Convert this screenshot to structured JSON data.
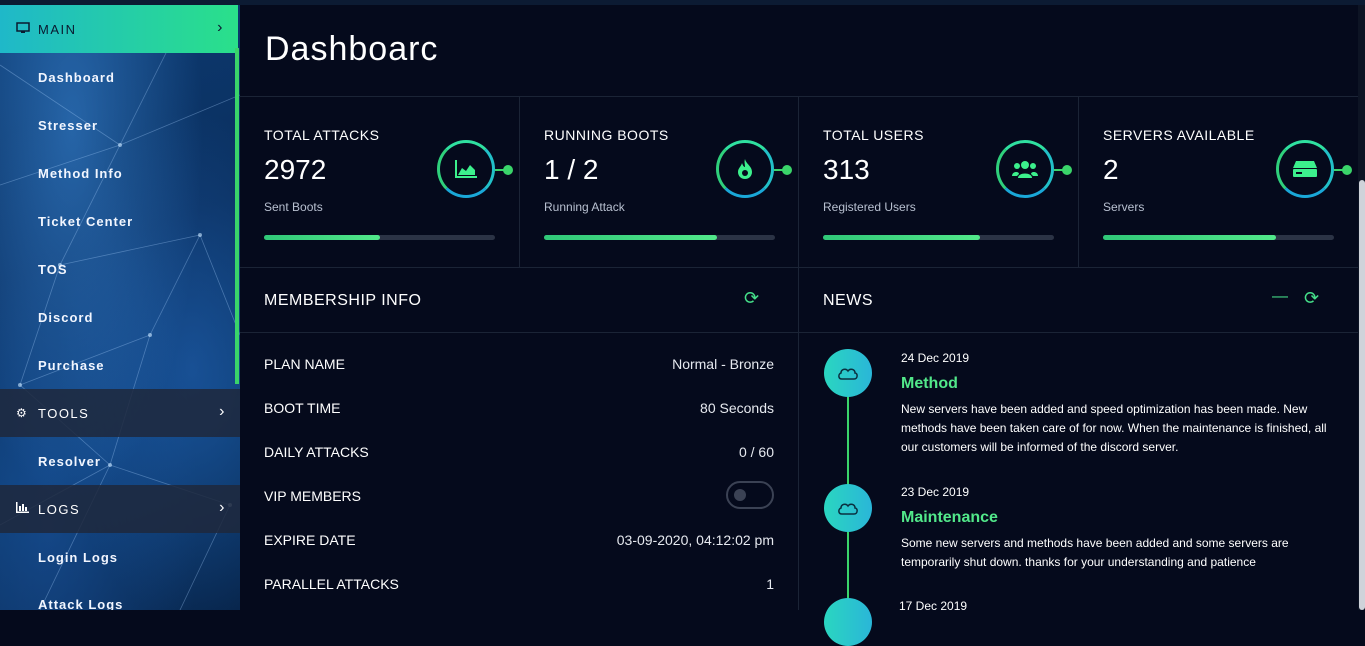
{
  "sidebar": {
    "sections": {
      "main": {
        "label": "MAIN"
      },
      "tools": {
        "label": "TOOLS"
      },
      "logs": {
        "label": "LOGS"
      }
    },
    "main_items": [
      "Dashboard",
      "Stresser",
      "Method Info",
      "Ticket Center",
      "TOS",
      "Discord",
      "Purchase"
    ],
    "tools_items": [
      "Resolver"
    ],
    "logs_items": [
      "Login Logs",
      "Attack Logs"
    ]
  },
  "page": {
    "title": "Dashboarc"
  },
  "stats": [
    {
      "label": "TOTAL ATTACKS",
      "value": "2972",
      "sub": "Sent Boots",
      "progress": 0.5,
      "icon": "chart-area-icon"
    },
    {
      "label": "RUNNING BOOTS",
      "value": "1 / 2",
      "sub": "Running Attack",
      "progress": 0.75,
      "icon": "fire-icon"
    },
    {
      "label": "TOTAL USERS",
      "value": "313",
      "sub": "Registered Users",
      "progress": 0.68,
      "icon": "users-icon"
    },
    {
      "label": "SERVERS AVAILABLE",
      "value": "2",
      "sub": "Servers",
      "progress": 0.75,
      "icon": "server-icon"
    }
  ],
  "membership": {
    "title": "MEMBERSHIP INFO",
    "rows": [
      {
        "label": "PLAN NAME",
        "value": "Normal - Bronze"
      },
      {
        "label": "BOOT TIME",
        "value": "80 Seconds"
      },
      {
        "label": "DAILY ATTACKS",
        "value": "0 / 60"
      },
      {
        "label": "VIP MEMBERS",
        "value": ""
      },
      {
        "label": "EXPIRE DATE",
        "value": "03-09-2020, 04:12:02 pm"
      },
      {
        "label": "PARALLEL ATTACKS",
        "value": "1"
      }
    ],
    "vip_enabled": false
  },
  "news": {
    "title": "NEWS",
    "items": [
      {
        "date": "24 Dec 2019",
        "title": "Method",
        "body": "New servers have been added and speed optimization has been made. New methods have been taken care of for now. When the maintenance is finished, all our customers will be informed of the discord server."
      },
      {
        "date": "23 Dec 2019",
        "title": "Maintenance",
        "body": "Some new servers and methods have been added and some servers are temporarily shut down. thanks for your understanding and patience"
      },
      {
        "date": "17 Dec 2019",
        "title": "",
        "body": ""
      }
    ]
  },
  "colors": {
    "accent": "#3ad46a",
    "background": "#050a1c",
    "sidebar": "#0b3a6e"
  }
}
